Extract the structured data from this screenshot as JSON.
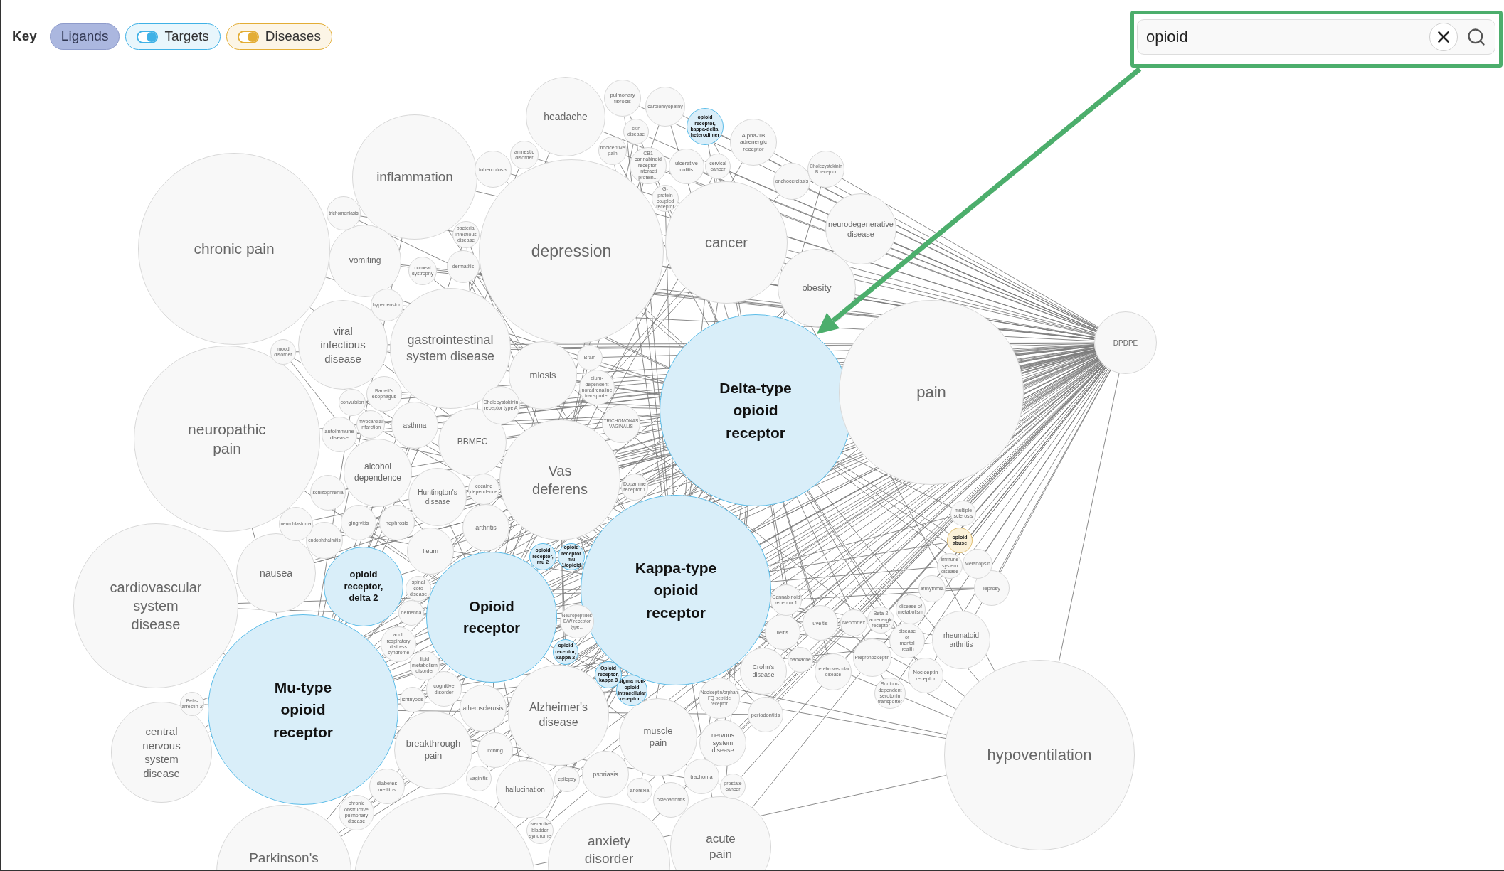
{
  "key": {
    "label": "Key",
    "items": [
      {
        "label": "Ligands",
        "kind": "button",
        "color": "#abb7df",
        "on": true
      },
      {
        "label": "Targets",
        "kind": "toggle",
        "color": "#3fb1e6",
        "on": true
      },
      {
        "label": "Diseases",
        "kind": "toggle",
        "color": "#e3ad35",
        "on": true
      }
    ]
  },
  "search": {
    "value": "opioid"
  },
  "graph": {
    "nodes": [
      {
        "label": "pulmonary fibrosis",
        "highlighted": false
      },
      {
        "label": "headache",
        "highlighted": false
      },
      {
        "label": "cardiomyopathy",
        "highlighted": false
      },
      {
        "label": "skin disease",
        "highlighted": false
      },
      {
        "label": "opioid receptor, kappa-delta, heterodimer",
        "highlighted": true,
        "kind": "target"
      },
      {
        "label": "amnestic disorder",
        "highlighted": false
      },
      {
        "label": "nociceptive pain",
        "highlighted": false
      },
      {
        "label": "Alpha-1B adrenergic receptor",
        "highlighted": false
      },
      {
        "label": "tuberculosis",
        "highlighted": false
      },
      {
        "label": "inflammation",
        "highlighted": false
      },
      {
        "label": "CB1 cannabinoid receptor-interacti protein...",
        "highlighted": false
      },
      {
        "label": "ulcerative colitis",
        "highlighted": false
      },
      {
        "label": "cervical cancer",
        "highlighted": false
      },
      {
        "label": "onchocerciasis",
        "highlighted": false
      },
      {
        "label": "Cholecystokinin B receptor",
        "highlighted": false
      },
      {
        "label": "G-protein coupled receptor",
        "highlighted": false
      },
      {
        "label": "trichomoniasis",
        "highlighted": false
      },
      {
        "label": "bacterial infectious disease",
        "highlighted": false
      },
      {
        "label": "chronic pain",
        "highlighted": false
      },
      {
        "label": "vomiting",
        "highlighted": false
      },
      {
        "label": "depression",
        "highlighted": false
      },
      {
        "label": "cancer",
        "highlighted": false
      },
      {
        "label": "neurodegenerative disease",
        "highlighted": false
      },
      {
        "label": "corneal dystrophy",
        "highlighted": false
      },
      {
        "label": "dermatitis",
        "highlighted": false
      },
      {
        "label": "obesity",
        "highlighted": false
      },
      {
        "label": "hypertension",
        "highlighted": false
      },
      {
        "label": "mood disorder",
        "highlighted": false
      },
      {
        "label": "viral infectious disease",
        "highlighted": false
      },
      {
        "label": "gastrointestinal system disease",
        "highlighted": false
      },
      {
        "label": "DPDPE",
        "highlighted": false
      },
      {
        "label": "Brain",
        "highlighted": false
      },
      {
        "label": "miosis",
        "highlighted": false
      },
      {
        "label": "convulsion",
        "highlighted": false
      },
      {
        "label": "Barrett's esophagus",
        "highlighted": false
      },
      {
        "label": "dium-dependent noradrenaline transporter",
        "highlighted": false
      },
      {
        "label": "Cholecystokinin receptor type A",
        "highlighted": false
      },
      {
        "label": "neuropathic pain",
        "highlighted": false
      },
      {
        "label": "autoimmune disease",
        "highlighted": false
      },
      {
        "label": "myocardial infarction",
        "highlighted": false
      },
      {
        "label": "asthma",
        "highlighted": false
      },
      {
        "label": "alcohol dependence",
        "highlighted": false
      },
      {
        "label": "BBMEC",
        "highlighted": false
      },
      {
        "label": "TRICHOMONAS VAGINALIS",
        "highlighted": false
      },
      {
        "label": "Delta-type opioid receptor",
        "highlighted": true,
        "kind": "target"
      },
      {
        "label": "pain",
        "highlighted": false
      },
      {
        "label": "schizophrenia",
        "highlighted": false
      },
      {
        "label": "Huntington's disease",
        "highlighted": false
      },
      {
        "label": "cocaine dependence",
        "highlighted": false
      },
      {
        "label": "Vas deferens",
        "highlighted": false
      },
      {
        "label": "Dopamine receptor 1",
        "highlighted": false
      },
      {
        "label": "neuroblastoma",
        "highlighted": false
      },
      {
        "label": "gingivitis",
        "highlighted": false
      },
      {
        "label": "nephrosis",
        "highlighted": false
      },
      {
        "label": "multiple sclerosis",
        "highlighted": false
      },
      {
        "label": "endophthalmitis",
        "highlighted": false
      },
      {
        "label": "arthritis",
        "highlighted": false
      },
      {
        "label": "cardiovascular system disease",
        "highlighted": false
      },
      {
        "label": "nausea",
        "highlighted": false
      },
      {
        "label": "Ileum",
        "highlighted": false
      },
      {
        "label": "opioid receptor, mu 2",
        "highlighted": true,
        "kind": "target"
      },
      {
        "label": "opioid receptor mu 1/opioid",
        "highlighted": true,
        "kind": "target"
      },
      {
        "label": "opioid abuse",
        "highlighted": true,
        "kind": "disease"
      },
      {
        "label": "immune system disease",
        "highlighted": false
      },
      {
        "label": "Melanopsin",
        "highlighted": false
      },
      {
        "label": "opioid receptor, delta 2",
        "highlighted": true,
        "kind": "target"
      },
      {
        "label": "spinal cord disease",
        "highlighted": false
      },
      {
        "label": "dementia",
        "highlighted": false
      },
      {
        "label": "Opioid receptor",
        "highlighted": true,
        "kind": "target"
      },
      {
        "label": "Kappa-type opioid receptor",
        "highlighted": true,
        "kind": "target"
      },
      {
        "label": "Cannabinoid receptor 1",
        "highlighted": false
      },
      {
        "label": "arrhythmia",
        "highlighted": false
      },
      {
        "label": "leprosy",
        "highlighted": false
      },
      {
        "label": "adult respiratory distress syndrome",
        "highlighted": false
      },
      {
        "label": "Neuropeptides B/W receptor type...",
        "highlighted": false
      },
      {
        "label": "ileitis",
        "highlighted": false
      },
      {
        "label": "uveitis",
        "highlighted": false
      },
      {
        "label": "Neocortex",
        "highlighted": false
      },
      {
        "label": "Beta-2 adrenergic receptor",
        "highlighted": false
      },
      {
        "label": "disease of metabolism",
        "highlighted": false
      },
      {
        "label": "opioid receptor, kappa 2",
        "highlighted": true,
        "kind": "target"
      },
      {
        "label": "lipid metabolism disorder",
        "highlighted": false
      },
      {
        "label": "Opioid receptor, kappa 3",
        "highlighted": true,
        "kind": "target"
      },
      {
        "label": "Crohn's disease",
        "highlighted": false
      },
      {
        "label": "backache",
        "highlighted": false
      },
      {
        "label": "Beta-arrestin-2",
        "highlighted": false
      },
      {
        "label": "Mu-type opioid receptor",
        "highlighted": true,
        "kind": "target"
      },
      {
        "label": "ichthyosis",
        "highlighted": false
      },
      {
        "label": "cognitive disorder",
        "highlighted": false
      },
      {
        "label": "Sigma non-opioid intracellular receptor...",
        "highlighted": true,
        "kind": "target"
      },
      {
        "label": "cerebrovascular disease",
        "highlighted": false
      },
      {
        "label": "Prepronociceptin",
        "highlighted": false
      },
      {
        "label": "disease of mental health",
        "highlighted": false
      },
      {
        "label": "rheumatoid arthritis",
        "highlighted": false
      },
      {
        "label": "Nociceptin receptor",
        "highlighted": false
      },
      {
        "label": "atherosclerosis",
        "highlighted": false
      },
      {
        "label": "central nervous system disease",
        "highlighted": false
      },
      {
        "label": "breakthrough pain",
        "highlighted": false
      },
      {
        "label": "Alzheimer's disease",
        "highlighted": false
      },
      {
        "label": "Nociceptin/orphan FQ peptide receptor",
        "highlighted": false
      },
      {
        "label": "Sodium-dependent serotonin transporter",
        "highlighted": false
      },
      {
        "label": "periodontitis",
        "highlighted": false
      },
      {
        "label": "itching",
        "highlighted": false
      },
      {
        "label": "muscle pain",
        "highlighted": false
      },
      {
        "label": "nervous system disease",
        "highlighted": false
      },
      {
        "label": "diabetes mellitus",
        "highlighted": false
      },
      {
        "label": "vaginitis",
        "highlighted": false
      },
      {
        "label": "hallucination",
        "highlighted": false
      },
      {
        "label": "epilepsy",
        "highlighted": false
      },
      {
        "label": "psoriasis",
        "highlighted": false
      },
      {
        "label": "hypoventilation",
        "highlighted": false
      },
      {
        "label": "anorexia",
        "highlighted": false
      },
      {
        "label": "trachoma",
        "highlighted": false
      },
      {
        "label": "prostate cancer",
        "highlighted": false
      },
      {
        "label": "chronic obstructive pulmonary disease",
        "highlighted": false
      },
      {
        "label": "osteoarthritis",
        "highlighted": false
      },
      {
        "label": "overactive bladder syndrome",
        "highlighted": false
      },
      {
        "label": "Parkinson's",
        "highlighted": false
      },
      {
        "highlighted": false
      },
      {
        "label": "anxiety disorder",
        "highlighted": false
      },
      {
        "label": "acute pain",
        "highlighted": false
      }
    ]
  }
}
